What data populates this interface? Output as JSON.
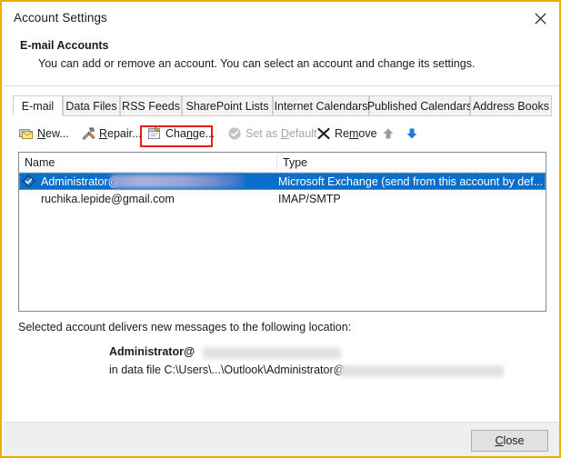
{
  "window": {
    "title": "Account Settings",
    "close_icon": "close-x-icon",
    "border_color": "#f0ab00"
  },
  "header": {
    "title": "E-mail Accounts",
    "description": "You can add or remove an account. You can select an account and change its settings."
  },
  "tabs": [
    {
      "label": "E-mail",
      "active": true
    },
    {
      "label": "Data Files",
      "active": false
    },
    {
      "label": "RSS Feeds",
      "active": false
    },
    {
      "label": "SharePoint Lists",
      "active": false
    },
    {
      "label": "Internet Calendars",
      "active": false
    },
    {
      "label": "Published Calendars",
      "active": false
    },
    {
      "label": "Address Books",
      "active": false
    }
  ],
  "toolbar": {
    "new_label": "New...",
    "new_label_pre": "",
    "new_accel": "N",
    "new_label_post": "ew...",
    "repair_accel": "R",
    "repair_label_post": "epair...",
    "change_pre": "Cha",
    "change_accel": "n",
    "change_post": "ge...",
    "setdefault_pre": "Set as ",
    "setdefault_accel": "D",
    "setdefault_post": "efault",
    "remove_pre": "Re",
    "remove_accel": "m",
    "remove_post": "ove",
    "move_up_icon": "arrow-up-icon",
    "move_down_icon": "arrow-down-icon",
    "highlight_color": "#e02020",
    "highlighted_button": "Change..."
  },
  "account_list": {
    "columns": [
      {
        "key": "name",
        "label": "Name"
      },
      {
        "key": "type",
        "label": "Type"
      }
    ],
    "rows": [
      {
        "name": "Administrator@",
        "name_redacted": true,
        "type": "Microsoft Exchange (send from this account by def...",
        "selected": true,
        "is_default": true
      },
      {
        "name": "ruchika.lepide@gmail.com",
        "name_redacted": false,
        "type": "IMAP/SMTP",
        "selected": false,
        "is_default": false
      }
    ],
    "selection_color": "#0b6fc9"
  },
  "delivery": {
    "label": "Selected account delivers new messages to the following location:",
    "account": "Administrator@",
    "path": "in data file C:\\Users\\...\\Outlook\\Administrator@"
  },
  "footer": {
    "close_pre": "",
    "close_accel": "C",
    "close_post": "lose"
  }
}
